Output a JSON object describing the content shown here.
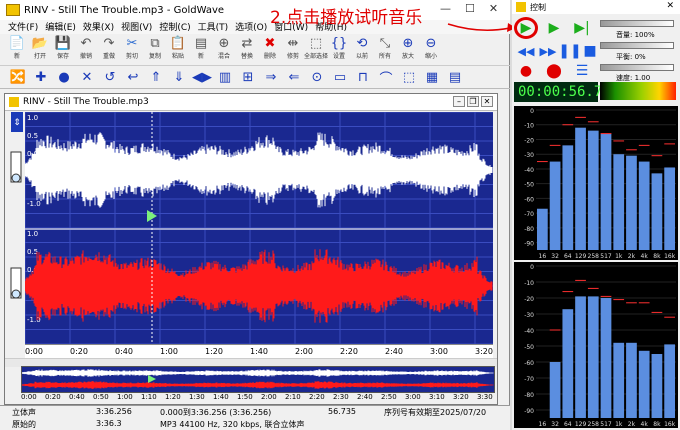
{
  "window": {
    "title": "RINV - Still The Trouble.mp3 - GoldWave",
    "controls": [
      "—",
      "☐",
      "✕"
    ]
  },
  "annotation": "2.点击播放试听音乐",
  "menu": [
    "文件(F)",
    "编辑(E)",
    "效果(X)",
    "视图(V)",
    "控制(C)",
    "工具(T)",
    "选项(O)",
    "窗口(W)",
    "帮助(H)"
  ],
  "toolbar1": [
    {
      "label": "新",
      "icon": "📄"
    },
    {
      "label": "打开",
      "icon": "📂"
    },
    {
      "label": "保存",
      "icon": "💾"
    },
    {
      "label": "撤销",
      "icon": "↶"
    },
    {
      "label": "重做",
      "icon": "↷"
    },
    {
      "label": "剪切",
      "icon": "✂"
    },
    {
      "label": "复制",
      "icon": "⧉"
    },
    {
      "label": "粘贴",
      "icon": "📋"
    },
    {
      "label": "新",
      "icon": "▤"
    },
    {
      "label": "混合",
      "icon": "⊕"
    },
    {
      "label": "替换",
      "icon": "⇄"
    },
    {
      "label": "删除",
      "icon": "✖"
    },
    {
      "label": "修剪",
      "icon": "⇹"
    },
    {
      "label": "全部选择",
      "icon": "⬚"
    },
    {
      "label": "设置",
      "icon": "{}"
    },
    {
      "label": "以前",
      "icon": "⟲"
    },
    {
      "label": "所有",
      "icon": "⤡"
    },
    {
      "label": "放大",
      "icon": "⊕"
    },
    {
      "label": "缩小",
      "icon": "⊖"
    }
  ],
  "toolbar2_icons": [
    "🔀",
    "✚",
    "●",
    "✕",
    "↺",
    "↩",
    "⇑",
    "⇓",
    "◀▶",
    "▥",
    "⊞",
    "⇒",
    "⇐",
    "⊙",
    "▭",
    "⊓",
    "⌒",
    "⬚",
    "▦",
    "▤"
  ],
  "document": {
    "title": "RINV - Still The Trouble.mp3",
    "controls": [
      "–",
      "❐",
      "✕"
    ],
    "timeline": [
      "0:00",
      "0:20",
      "0:40",
      "1:00",
      "1:20",
      "1:40",
      "2:00",
      "2:20",
      "2:40",
      "3:00",
      "3:20"
    ],
    "overview_times": [
      "0:00",
      "0:20",
      "0:40",
      "0:50",
      "1:00",
      "1:10",
      "1:20",
      "1:30",
      "1:40",
      "1:50",
      "2:00",
      "2:10",
      "2:20",
      "2:30",
      "2:40",
      "2:50",
      "3:00",
      "3:10",
      "3:20",
      "3:30"
    ],
    "scale": [
      "1.0",
      "0.5",
      "0.0",
      "-0.5",
      "-1.0"
    ]
  },
  "status": {
    "channel": "立体声",
    "length": "3:36.256",
    "selection": "0.000到3:36.256 (3:36.256)",
    "position": "56.735",
    "license": "序列号有效期至2025/07/20",
    "orig_label": "原始的",
    "orig_length": "3:36.3",
    "format": "MP3 44100 Hz, 320 kbps, 联合立体声"
  },
  "control": {
    "title": "控制",
    "volume": "音量: 100%",
    "balance": "平衡: 0%",
    "speed": "速度: 1.00",
    "time": "00:00:56.7"
  },
  "spectrum": {
    "y_ticks": [
      "0",
      "-10",
      "-20",
      "-30",
      "-40",
      "-50",
      "-60",
      "-70",
      "-80",
      "-90"
    ],
    "x_ticks": [
      "16",
      "32",
      "64",
      "129",
      "258",
      "517",
      "1k",
      "2k",
      "4k",
      "8k",
      "16k"
    ]
  },
  "chart_data": [
    {
      "type": "bar",
      "title": "",
      "categories": [
        "16",
        "32",
        "64",
        "129",
        "258",
        "517",
        "1k",
        "2k",
        "4k",
        "8k",
        "16k"
      ],
      "values": [
        -67,
        -35,
        -24,
        -12,
        -14,
        -16,
        -30,
        -31,
        -35,
        -43,
        -39
      ],
      "peaks": [
        -35,
        -24,
        -10,
        -5,
        -8,
        -16,
        -21,
        -27,
        -24,
        -31,
        -23
      ],
      "ylim": [
        -95,
        0
      ]
    },
    {
      "type": "bar",
      "title": "",
      "categories": [
        "16",
        "32",
        "64",
        "129",
        "258",
        "517",
        "1k",
        "2k",
        "4k",
        "8k",
        "16k"
      ],
      "values": [
        -95,
        -60,
        -27,
        -19,
        -19,
        -20,
        -48,
        -48,
        -53,
        -55,
        -49
      ],
      "peaks": [
        -95,
        -40,
        -16,
        -9,
        -14,
        -19,
        -21,
        -23,
        -23,
        -29,
        -32
      ],
      "ylim": [
        -95,
        0
      ]
    }
  ]
}
